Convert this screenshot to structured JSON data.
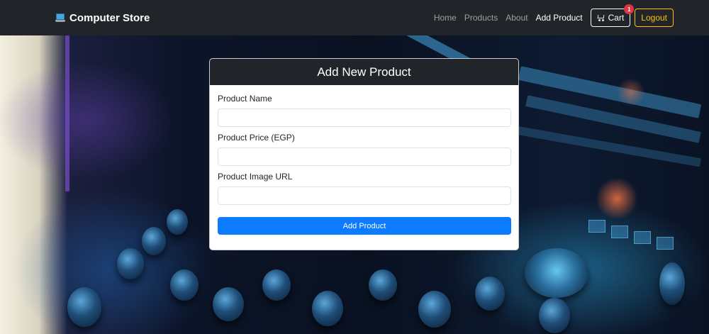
{
  "navbar": {
    "brand_icon": "laptop-icon",
    "brand_text": "Computer Store",
    "links": [
      {
        "label": "Home",
        "active": false
      },
      {
        "label": "Products",
        "active": false
      },
      {
        "label": "About",
        "active": false
      },
      {
        "label": "Add Product",
        "active": true
      }
    ],
    "cart": {
      "icon": "cart-icon",
      "label": "Cart",
      "badge_count": "1"
    },
    "logout_label": "Logout"
  },
  "form": {
    "title": "Add New Product",
    "fields": [
      {
        "label": "Product Name",
        "value": "",
        "placeholder": ""
      },
      {
        "label": "Product Price (EGP)",
        "value": "",
        "placeholder": ""
      },
      {
        "label": "Product Image URL",
        "value": "",
        "placeholder": ""
      }
    ],
    "submit_label": "Add Product"
  },
  "colors": {
    "navbar_bg": "#212529",
    "primary": "#0d7bff",
    "warning": "#ffc107",
    "danger": "#dc3545"
  }
}
